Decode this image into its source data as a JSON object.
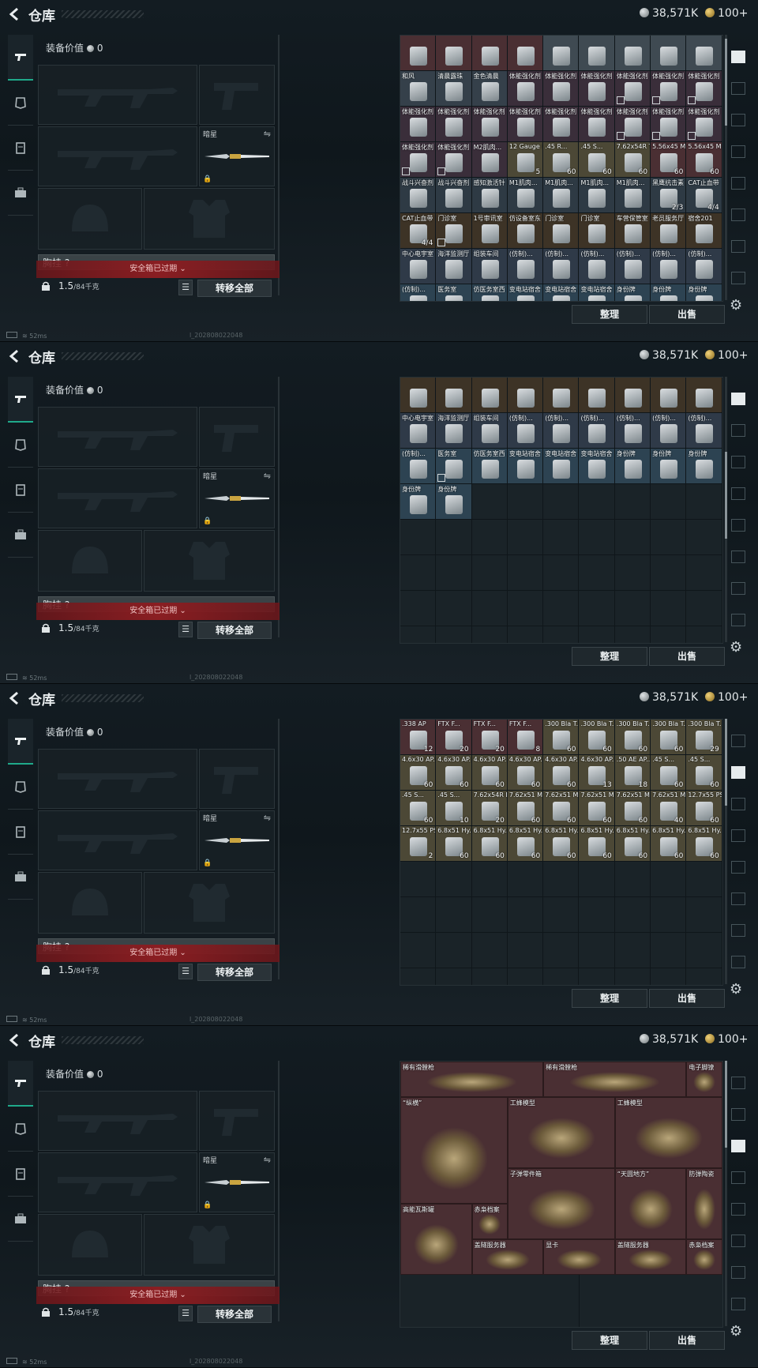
{
  "header": {
    "title": "仓库",
    "silver": "38,571K",
    "gold": "100",
    "gold_plus": "+"
  },
  "equipment": {
    "value_label": "装备价值",
    "value": "0",
    "melee_label": "暗星",
    "vest_label": "胸挂 ?",
    "warning": "安全箱已过期",
    "weight": "1.5",
    "weight_unit": "/84千克",
    "transfer_all": "转移全部"
  },
  "status": {
    "ping": "52ms",
    "build": "l_202808022048"
  },
  "actions": {
    "sort": "整理",
    "sell": "出售"
  },
  "panels": [
    {
      "id": "p1",
      "scroll": 0.02,
      "cells": [
        [
          "",
          "",
          "#4a2f33",
          "",
          ""
        ],
        [
          "",
          "",
          "#4a2f33",
          "",
          ""
        ],
        [
          "",
          "",
          "#4a2f33",
          "",
          ""
        ],
        [
          "",
          "",
          "#4a2f33",
          "",
          ""
        ],
        [
          "",
          "",
          "#3f4a52",
          "",
          ""
        ],
        [
          "",
          "",
          "#3f4a52",
          "",
          ""
        ],
        [
          "",
          "",
          "#3f4a52",
          "",
          ""
        ],
        [
          "",
          "",
          "#3f4a52",
          "",
          ""
        ],
        [
          "",
          "",
          "#3f4a52",
          "",
          ""
        ],
        [
          "和风",
          "",
          "#35404a",
          "",
          ""
        ],
        [
          "清晨露珠",
          "",
          "#35404a",
          "",
          ""
        ],
        [
          "金色清晨",
          "",
          "#35404a",
          "",
          ""
        ],
        [
          "体能强化剂",
          "",
          "#3a2e3a",
          "",
          ""
        ],
        [
          "体能强化剂",
          "",
          "#3a2e3a",
          "",
          ""
        ],
        [
          "体能强化剂",
          "",
          "#3a2e3a",
          "",
          ""
        ],
        [
          "体能强化剂",
          "",
          "#3a2e3a",
          "",
          "m"
        ],
        [
          "体能强化剂",
          "",
          "#3a2e3a",
          "",
          "m"
        ],
        [
          "体能强化剂",
          "",
          "#3a2e3a",
          "",
          "m"
        ],
        [
          "体能强化剂",
          "",
          "#3a2e3a",
          "",
          ""
        ],
        [
          "体能强化剂",
          "",
          "#3a2e3a",
          "",
          ""
        ],
        [
          "体能强化剂",
          "",
          "#3a2e3a",
          "",
          ""
        ],
        [
          "体能强化剂",
          "",
          "#3a2e3a",
          "",
          ""
        ],
        [
          "体能强化剂",
          "",
          "#3a2e3a",
          "",
          ""
        ],
        [
          "体能强化剂",
          "",
          "#3a2e3a",
          "",
          ""
        ],
        [
          "体能强化剂",
          "",
          "#3a2e3a",
          "",
          "m"
        ],
        [
          "体能强化剂",
          "",
          "#3a2e3a",
          "",
          "m"
        ],
        [
          "体能强化剂",
          "",
          "#3a2e3a",
          "",
          "m"
        ],
        [
          "体能强化剂",
          "",
          "#3a2e3a",
          "",
          "m"
        ],
        [
          "体能强化剂",
          "",
          "#3a2e3a",
          "",
          "m"
        ],
        [
          "M2肌肉...",
          "",
          "#3a2e3a",
          "",
          ""
        ],
        [
          "12 Gauge F...",
          "5",
          "#4c4836",
          "",
          ""
        ],
        [
          ".45 R...",
          "60",
          "#4c4836",
          "",
          ""
        ],
        [
          ".45 S...",
          "60",
          "#4c4836",
          "",
          ""
        ],
        [
          "7.62x54R T...",
          "60",
          "#4c4836",
          "",
          ""
        ],
        [
          "5.56x45 M...",
          "60",
          "#4a2f33",
          "",
          ""
        ],
        [
          "5.56x45 M...",
          "60",
          "#4a2f33",
          "",
          ""
        ],
        [
          "战斗兴奋剂",
          "",
          "#2e3a44",
          "",
          ""
        ],
        [
          "战斗兴奋剂",
          "",
          "#2e3a44",
          "",
          ""
        ],
        [
          "感知激活针",
          "",
          "#2e3a44",
          "",
          ""
        ],
        [
          "M1肌肉...",
          "",
          "#2e3a44",
          "",
          ""
        ],
        [
          "M1肌肉...",
          "",
          "#2e3a44",
          "",
          ""
        ],
        [
          "M1肌肉...",
          "",
          "#2e3a44",
          "",
          ""
        ],
        [
          "M1肌肉...",
          "",
          "#2e3a44",
          "",
          ""
        ],
        [
          "黑鹰抗击素",
          "2/3",
          "#2e3a44",
          "",
          ""
        ],
        [
          "CAT止血带",
          "4/4",
          "#2e3a44",
          "",
          ""
        ],
        [
          "CAT止血带",
          "4/4",
          "#3d3326",
          "",
          ""
        ],
        [
          "门诊室",
          "",
          "#3d3326",
          "",
          "m"
        ],
        [
          "1号审讯室",
          "",
          "#3d3326",
          "",
          ""
        ],
        [
          "仿设备室东",
          "",
          "#3d3326",
          "",
          ""
        ],
        [
          "门诊室",
          "",
          "#3d3326",
          "",
          ""
        ],
        [
          "门诊室",
          "",
          "#3d3326",
          "",
          ""
        ],
        [
          "车营保管室",
          "",
          "#3d3326",
          "",
          ""
        ],
        [
          "老员服务厅",
          "",
          "#3d3326",
          "",
          ""
        ],
        [
          "宿舍201",
          "",
          "#3d3326",
          "",
          ""
        ],
        [
          "中心电宇室",
          "",
          "#2f3a48",
          "",
          ""
        ],
        [
          "海洋监测厅",
          "",
          "#2f3a48",
          "",
          ""
        ],
        [
          "组装车间",
          "",
          "#2f3a48",
          "",
          ""
        ],
        [
          "(仿制)...",
          "",
          "#2f3a48",
          "",
          ""
        ],
        [
          "(仿制)...",
          "",
          "#2f3a48",
          "",
          ""
        ],
        [
          "(仿制)...",
          "",
          "#2f3a48",
          "",
          ""
        ],
        [
          "(仿制)...",
          "",
          "#2f3a48",
          "",
          ""
        ],
        [
          "(仿制)...",
          "",
          "#2f3a48",
          "",
          ""
        ],
        [
          "(仿制)...",
          "",
          "#2f3a48",
          "",
          ""
        ],
        [
          "(仿制)...",
          "",
          "#2d4352",
          "",
          ""
        ],
        [
          "医务室",
          "",
          "#2d4352",
          "",
          ""
        ],
        [
          "仿医务室西",
          "",
          "#2d4352",
          "",
          ""
        ],
        [
          "变电站宿舍",
          "",
          "#2d4352",
          "",
          ""
        ],
        [
          "变电站宿舍",
          "",
          "#2d4352",
          "",
          ""
        ],
        [
          "变电站宿舍",
          "",
          "#2d4352",
          "",
          ""
        ],
        [
          "身份牌",
          "",
          "#2d4352",
          "",
          ""
        ],
        [
          "身份牌",
          "",
          "#2d4352",
          "",
          ""
        ],
        [
          "身份牌",
          "",
          "#2d4352",
          "",
          ""
        ]
      ]
    },
    {
      "id": "p2",
      "scroll": 0.42,
      "cells": [
        [
          "",
          "",
          "#3d3326",
          "",
          ""
        ],
        [
          "",
          "",
          "#3d3326",
          "",
          ""
        ],
        [
          "",
          "",
          "#3d3326",
          "",
          ""
        ],
        [
          "",
          "",
          "#3d3326",
          "",
          ""
        ],
        [
          "",
          "",
          "#3d3326",
          "",
          ""
        ],
        [
          "",
          "",
          "#3d3326",
          "",
          ""
        ],
        [
          "",
          "",
          "#3d3326",
          "",
          ""
        ],
        [
          "",
          "",
          "#3d3326",
          "",
          ""
        ],
        [
          "",
          "",
          "#3d3326",
          "",
          ""
        ],
        [
          "中心电宇室",
          "",
          "#2f3a48",
          "",
          ""
        ],
        [
          "海洋监测厅",
          "",
          "#2f3a48",
          "",
          ""
        ],
        [
          "组装车间",
          "",
          "#2f3a48",
          "",
          ""
        ],
        [
          "(仿制)...",
          "",
          "#2f3a48",
          "",
          ""
        ],
        [
          "(仿制)...",
          "",
          "#2f3a48",
          "",
          ""
        ],
        [
          "(仿制)...",
          "",
          "#2f3a48",
          "",
          ""
        ],
        [
          "(仿制)...",
          "",
          "#2f3a48",
          "",
          ""
        ],
        [
          "(仿制)...",
          "",
          "#2f3a48",
          "",
          ""
        ],
        [
          "(仿制)...",
          "",
          "#2f3a48",
          "",
          ""
        ],
        [
          "(仿制)...",
          "",
          "#2d4352",
          "",
          ""
        ],
        [
          "医务室",
          "",
          "#2d4352",
          "",
          "m"
        ],
        [
          "仿医务室西",
          "",
          "#2d4352",
          "",
          ""
        ],
        [
          "变电站宿舍",
          "",
          "#2d4352",
          "",
          ""
        ],
        [
          "变电站宿舍",
          "",
          "#2d4352",
          "",
          ""
        ],
        [
          "变电站宿舍",
          "",
          "#2d4352",
          "",
          ""
        ],
        [
          "身份牌",
          "",
          "#2d4352",
          "",
          ""
        ],
        [
          "身份牌",
          "",
          "#2d4352",
          "",
          ""
        ],
        [
          "身份牌",
          "",
          "#2d4352",
          "",
          ""
        ],
        [
          "身份牌",
          "",
          "#2d4352",
          "",
          ""
        ],
        [
          "身份牌",
          "",
          "#2d4352",
          "",
          ""
        ]
      ]
    },
    {
      "id": "p3",
      "scroll": 0.0,
      "cells": [
        [
          ".338 AP",
          "12",
          "#4a2f33",
          "",
          ""
        ],
        [
          "FTX F...",
          "20",
          "#4a2f33",
          "",
          ""
        ],
        [
          "FTX F...",
          "20",
          "#4a2f33",
          "",
          ""
        ],
        [
          "FTX F...",
          "8",
          "#4a2f33",
          "",
          ""
        ],
        [
          ".300 Bla T...",
          "60",
          "#4c4836",
          "",
          ""
        ],
        [
          ".300 Bla T...",
          "60",
          "#4c4836",
          "",
          ""
        ],
        [
          ".300 Bla T...",
          "60",
          "#4c4836",
          "",
          ""
        ],
        [
          ".300 Bla T...",
          "60",
          "#4c4836",
          "",
          ""
        ],
        [
          ".300 Bla T...",
          "29",
          "#4c4836",
          "",
          ""
        ],
        [
          "4.6x30 AP...",
          "60",
          "#4c4836",
          "",
          ""
        ],
        [
          "4.6x30 AP...",
          "60",
          "#4c4836",
          "",
          ""
        ],
        [
          "4.6x30 AP...",
          "60",
          "#4c4836",
          "",
          ""
        ],
        [
          "4.6x30 AP...",
          "60",
          "#4c4836",
          "",
          ""
        ],
        [
          "4.6x30 AP...",
          "60",
          "#4c4836",
          "",
          ""
        ],
        [
          "4.6x30 AP...",
          "13",
          "#4c4836",
          "",
          ""
        ],
        [
          ".50 AE AP...",
          "18",
          "#4c4836",
          "",
          ""
        ],
        [
          ".45 S...",
          "60",
          "#4c4836",
          "",
          ""
        ],
        [
          ".45 S...",
          "60",
          "#4c4836",
          "",
          ""
        ],
        [
          ".45 S...",
          "60",
          "#4c4836",
          "",
          ""
        ],
        [
          ".45 S...",
          "10",
          "#4c4836",
          "",
          ""
        ],
        [
          "7.62x54R B...",
          "20",
          "#4c4836",
          "",
          ""
        ],
        [
          "7.62x51 M...",
          "60",
          "#4c4836",
          "",
          ""
        ],
        [
          "7.62x51 M...",
          "60",
          "#4c4836",
          "",
          ""
        ],
        [
          "7.62x51 M...",
          "60",
          "#4c4836",
          "",
          ""
        ],
        [
          "7.62x51 M...",
          "60",
          "#4c4836",
          "",
          ""
        ],
        [
          "7.62x51 M...",
          "40",
          "#4c4836",
          "",
          ""
        ],
        [
          "12.7x55 PS...",
          "60",
          "#4c4836",
          "",
          ""
        ],
        [
          "12.7x55 PS12B",
          "2",
          "#4c4836",
          "",
          ""
        ],
        [
          "6.8x51 Hy...",
          "60",
          "#4c4836",
          "",
          ""
        ],
        [
          "6.8x51 Hy...",
          "60",
          "#4c4836",
          "",
          ""
        ],
        [
          "6.8x51 Hy...",
          "60",
          "#4c4836",
          "",
          ""
        ],
        [
          "6.8x51 Hy...",
          "60",
          "#4c4836",
          "",
          ""
        ],
        [
          "6.8x51 Hy...",
          "60",
          "#4c4836",
          "",
          ""
        ],
        [
          "6.8x51 Hy...",
          "60",
          "#4c4836",
          "",
          ""
        ],
        [
          "6.8x51 Hy...",
          "60",
          "#4c4836",
          "",
          ""
        ],
        [
          "6.8x51 Hy...",
          "60",
          "#4c4836",
          "",
          ""
        ]
      ]
    },
    {
      "id": "p4",
      "scroll": 0.0,
      "big": [
        {
          "nm": "稀有滑膛枪",
          "col": 0,
          "row": 0,
          "cw": 4,
          "rh": 1,
          "bg": "#4a2f33"
        },
        {
          "nm": "稀有滑膛枪",
          "col": 4,
          "row": 0,
          "cw": 4,
          "rh": 1,
          "bg": "#4a2f33"
        },
        {
          "nm": "电子脚镣",
          "col": 8,
          "row": 0,
          "cw": 1,
          "rh": 1,
          "bg": "#4a2f33"
        },
        {
          "nm": "“纵横”",
          "col": 0,
          "row": 1,
          "cw": 3,
          "rh": 3,
          "bg": "#4a2f33"
        },
        {
          "nm": "工蜂模型",
          "col": 3,
          "row": 1,
          "cw": 3,
          "rh": 2,
          "bg": "#4a2f33"
        },
        {
          "nm": "工蜂模型",
          "col": 6,
          "row": 1,
          "cw": 3,
          "rh": 2,
          "bg": "#4a2f33"
        },
        {
          "nm": "子弹零件箱",
          "col": 3,
          "row": 3,
          "cw": 3,
          "rh": 2,
          "bg": "#4a2f33"
        },
        {
          "nm": "“天圆地方”",
          "col": 6,
          "row": 3,
          "cw": 2,
          "rh": 2,
          "bg": "#4a2f33"
        },
        {
          "nm": "防弹陶瓷",
          "col": 8,
          "row": 3,
          "cw": 1,
          "rh": 2,
          "bg": "#4a2f33"
        },
        {
          "nm": "高能瓦斯罐",
          "col": 0,
          "row": 4,
          "cw": 2,
          "rh": 2,
          "bg": "#4a2f33"
        },
        {
          "nm": "赤枭档案",
          "col": 2,
          "row": 4,
          "cw": 1,
          "rh": 1,
          "bg": "#4a2f33"
        },
        {
          "nm": "盖隧服务器",
          "col": 2,
          "row": 5,
          "cw": 2,
          "rh": 1,
          "bg": "#4a2f33"
        },
        {
          "nm": "显卡",
          "col": 4,
          "row": 5,
          "cw": 2,
          "rh": 1,
          "bg": "#4a2f33"
        },
        {
          "nm": "盖隧服务器",
          "col": 6,
          "row": 5,
          "cw": 2,
          "rh": 1,
          "bg": "#4a2f33"
        },
        {
          "nm": "赤枭档案",
          "col": 8,
          "row": 5,
          "cw": 1,
          "rh": 1,
          "bg": "#4a2f33"
        }
      ]
    }
  ]
}
